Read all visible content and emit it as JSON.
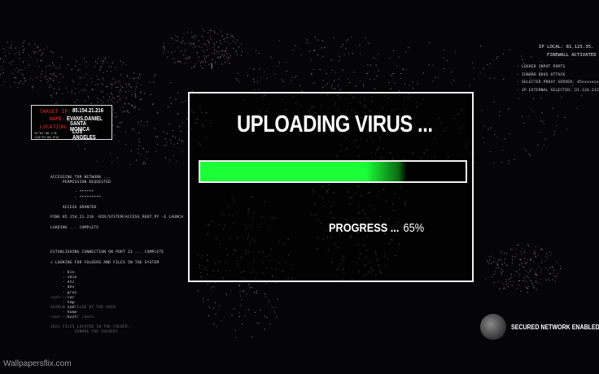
{
  "target": {
    "ip_label": "TARGET IP:",
    "ip": "85.154.21.216",
    "name_label": "NAME:",
    "name": "EVANS.DANIEL",
    "location_label": "LOCATION:",
    "location": "SANTA MONICA",
    "coords_1": "34°01'06.1\"N",
    "coords_2": "118°29'00.9\"W",
    "city": "LOS ANGELES",
    "accent": "#e32b2b"
  },
  "terminal": [
    "ACCESSING TOR NETWORK ...",
    "     PERMISSION REQUESTED",
    "",
    "          - ******",
    "          - *********",
    "",
    "     ACCESS GRANTED",
    "",
    "PING 85.154.21.216 -DIR/SYSTEM/ACCESS_ROOT.PY -E LAUNCH",
    "",
    "LOADING ... COMPLETE",
    "",
    "",
    "",
    "",
    "ESTABLISHING CONNECTION ON PORT 23 ... COMPLETE",
    "",
    "> LOOKING FOR FOLDERS AND FILES IN THE SYSTEM",
    "",
    "     - bin",
    "     - sbin",
    "     - etc",
    "     - dev",
    "     - proc",
    "     - var",
    "     - tmp",
    "     - usr",
    "     - home",
    "     - boot"
  ],
  "terminal_dim": [
    "root: /v.",
    "",
    "SEARCH CANCELED BY THE USER",
    "",
    "root: /audit /data",
    "",
    "2021 FILES LOCATED IN THE FOLDER,",
    "          IGNORE THE FOLDER?"
  ],
  "status_right": {
    "ip_local": "IP LOCAL: 81.125.35.",
    "firewall": "FIREWALL ACTIVATED",
    "items": [
      "- LOCKED INPUT PORTS",
      "- IGNORE DDOS ATTACK",
      "- SELECTED PROXY SERVER: 45xxxxxxx",
      "- IP EXTERNAL SELECTED: 31.124.232.1"
    ]
  },
  "dialog": {
    "title": "UPLOADING VIRUS ...",
    "progress_label": "PROGRESS ...",
    "progress_text": "65%",
    "progress_fill_percent": 65,
    "bar_color": "#1cff38"
  },
  "secured": {
    "icon": "lock-globe-icon",
    "label": "SECURED NETWORK ENABLED"
  },
  "watermark": "Wallpapersflix.com"
}
